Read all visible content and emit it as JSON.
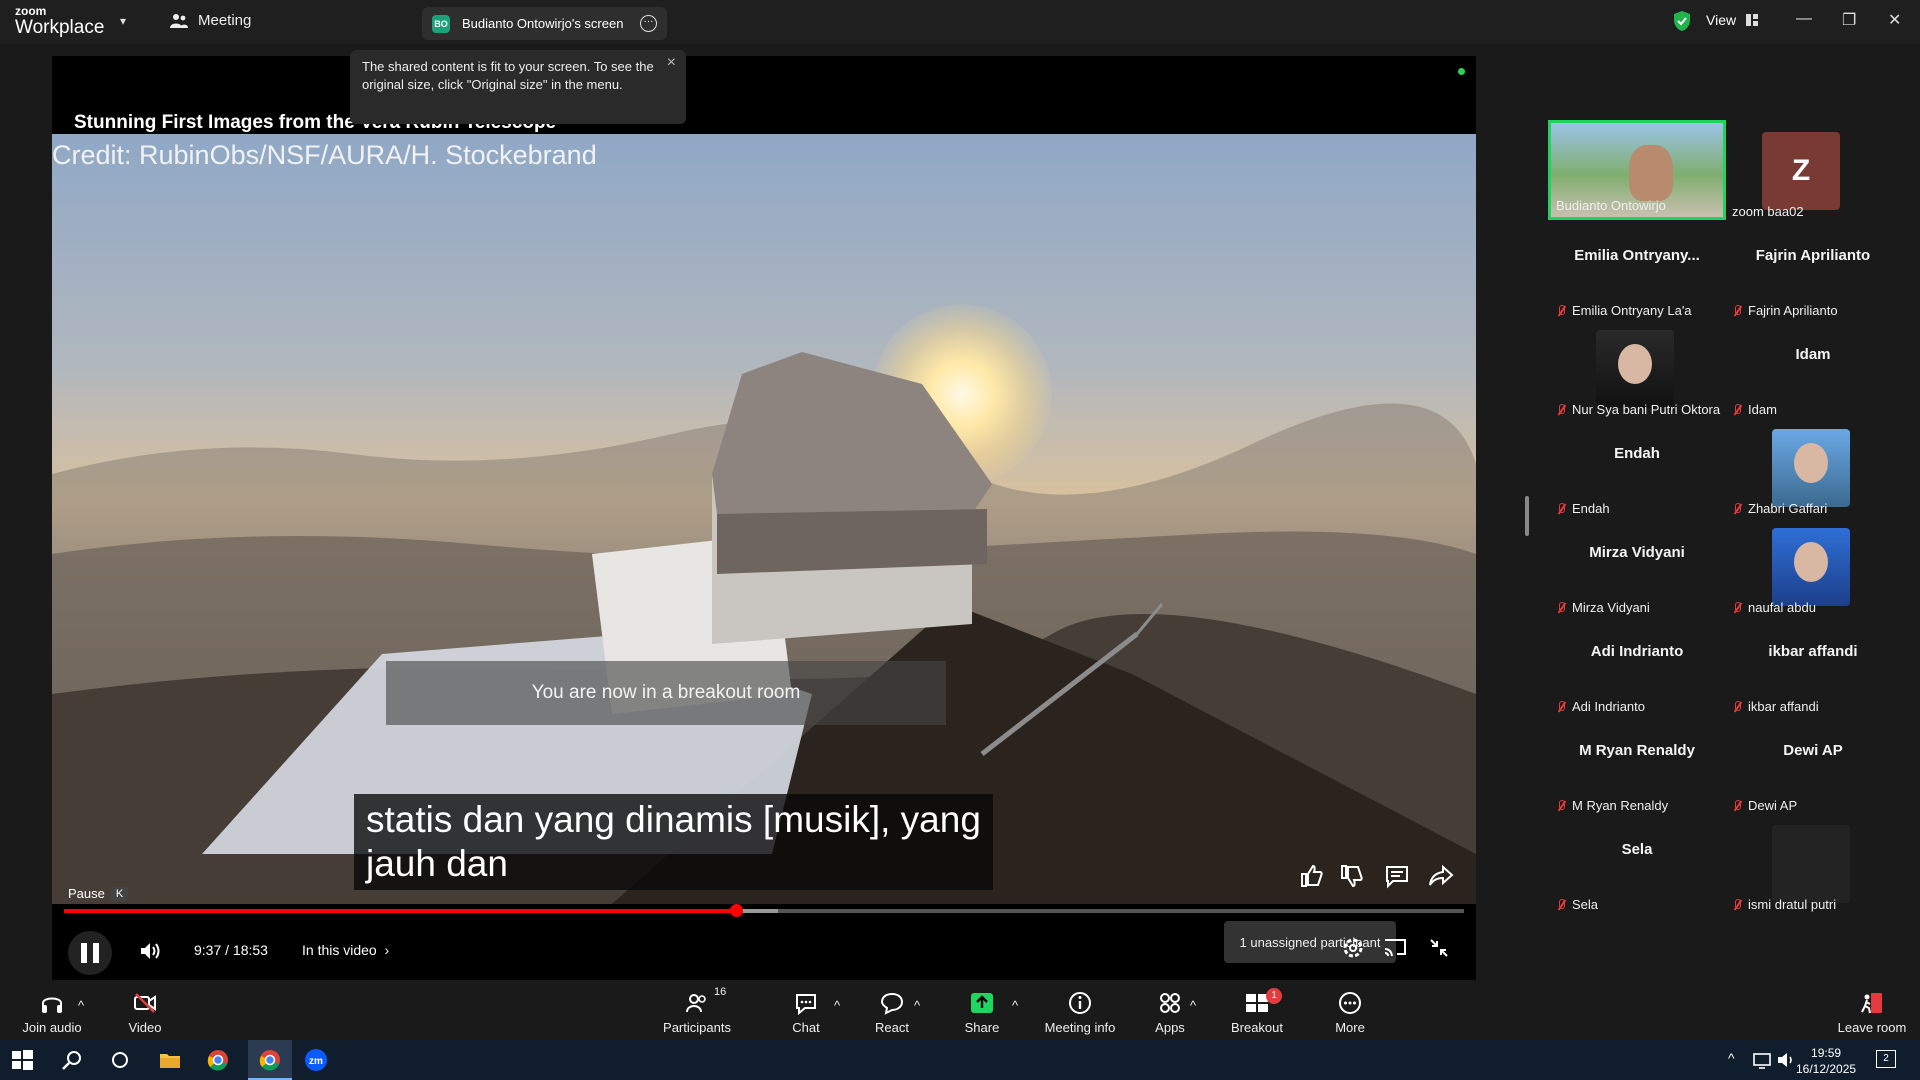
{
  "app": {
    "brand_top": "zoom",
    "brand_bottom": "Workplace",
    "meeting_menu": "Meeting"
  },
  "share_tab": {
    "badge": "BO",
    "title": "Budianto Ontowirjo's screen"
  },
  "view_label": "View",
  "tooltip": {
    "text": "The shared content is fit to your screen. To see the original size, click \"Original size\" in the menu."
  },
  "video": {
    "title": "Stunning First Images from the Vera Rubin Telescope",
    "credit": "Credit: RubinObs/NSF/AURA/H. Stockebrand",
    "breakout_message": "You are now in a breakout room",
    "subtitle_line1": "statis dan yang dinamis [musik], yang",
    "subtitle_line2": "jauh dan",
    "pause_label": "Pause",
    "pause_key": "K",
    "time": "9:37 / 18:53",
    "chapter": "In this video",
    "progress": 0.48,
    "buffered": 0.51,
    "unassigned": "1 unassigned participant"
  },
  "participants": [
    {
      "display": "Budianto Ontowirjo",
      "label": "Budianto Ontowirjo",
      "type": "video",
      "active": true
    },
    {
      "display": "Z",
      "label": "zoom baa02",
      "type": "avatar",
      "color": "#7a3a34"
    },
    {
      "display": "Emilia  Ontryany...",
      "label": "Emilia Ontryany La'a",
      "type": "name",
      "muted": true
    },
    {
      "display": "Fajrin Aprilianto",
      "label": "Fajrin Aprilianto",
      "type": "name",
      "muted": true
    },
    {
      "display": "",
      "label": "Nur Sya bani Putri Oktora",
      "type": "photo",
      "muted": true
    },
    {
      "display": "Idam",
      "label": "Idam",
      "type": "name",
      "muted": true
    },
    {
      "display": "Endah",
      "label": "Endah",
      "type": "name",
      "muted": true
    },
    {
      "display": "",
      "label": "Zhabri Gaffari",
      "type": "photo",
      "muted": true
    },
    {
      "display": "Mirza Vidyani",
      "label": "Mirza Vidyani",
      "type": "name",
      "muted": true
    },
    {
      "display": "",
      "label": "naufal abdu",
      "type": "photo",
      "muted": true
    },
    {
      "display": "Adi Indrianto",
      "label": "Adi Indrianto",
      "type": "name",
      "muted": true
    },
    {
      "display": "ikbar affandi",
      "label": "ikbar affandi",
      "type": "name",
      "muted": true
    },
    {
      "display": "M Ryan Renaldy",
      "label": "M Ryan Renaldy",
      "type": "name",
      "muted": true
    },
    {
      "display": "Dewi AP",
      "label": "Dewi AP",
      "type": "name",
      "muted": true
    },
    {
      "display": "Sela",
      "label": "Sela",
      "type": "name",
      "muted": true
    },
    {
      "display": "",
      "label": "ismi dratul putri",
      "type": "blank",
      "muted": true
    }
  ],
  "toolbar": {
    "join_audio": "Join audio",
    "video": "Video",
    "participants": "Participants",
    "participants_count": "16",
    "chat": "Chat",
    "react": "React",
    "share": "Share",
    "meeting_info": "Meeting info",
    "apps": "Apps",
    "breakout_rooms": "Breakout rooms",
    "breakout_badge": "1",
    "more": "More",
    "leave_room": "Leave room"
  },
  "taskbar": {
    "time": "19:59",
    "date": "16/12/2025",
    "notifications": "2"
  },
  "colors": {
    "accent": "#0e72ed",
    "active_border": "#23d160",
    "share_green": "#1ed760",
    "muted_red": "#e43c3c",
    "progress_red": "#ff0000"
  }
}
